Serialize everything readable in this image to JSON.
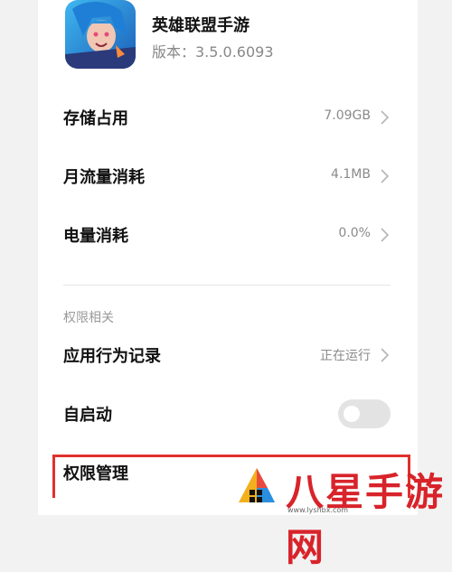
{
  "app": {
    "name": "英雄联盟手游",
    "version": "版本：3.5.0.6093"
  },
  "rows": {
    "storage": {
      "label": "存储占用",
      "value": "7.09GB"
    },
    "data_usage": {
      "label": "月流量消耗",
      "value": "4.1MB"
    },
    "battery": {
      "label": "电量消耗",
      "value": "0.0%"
    },
    "behavior": {
      "label": "应用行为记录",
      "value": "正在运行"
    },
    "autostart": {
      "label": "自启动",
      "toggle_on": false
    },
    "permissions": {
      "label": "权限管理"
    }
  },
  "section": {
    "permissions_title": "权限相关"
  },
  "watermark": {
    "text": "八星手游网",
    "url": "www.lyshbx.com"
  },
  "colors": {
    "highlight": "#e0312d",
    "watermark": "#d8232a"
  }
}
